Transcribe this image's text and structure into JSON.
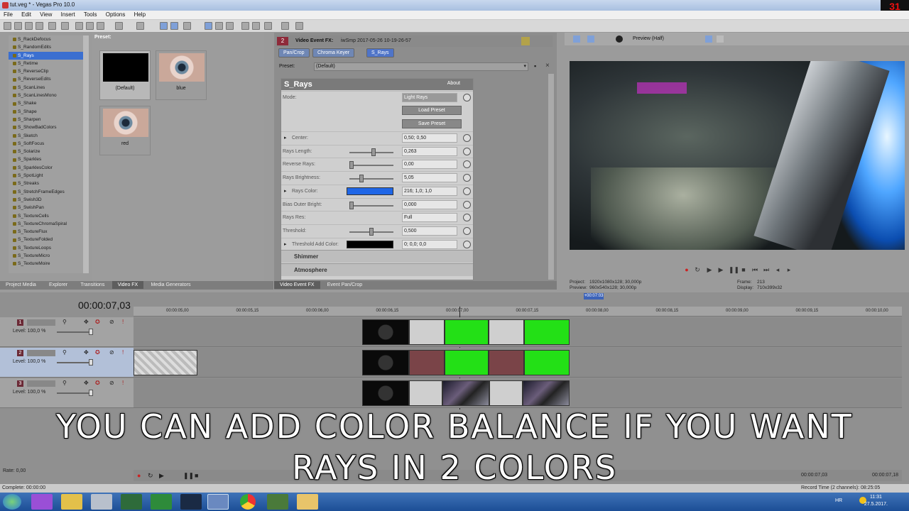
{
  "window": {
    "title": "tut.veg * - Vegas Pro 10.0",
    "corner_counter": "31"
  },
  "menu": [
    "File",
    "Edit",
    "View",
    "Insert",
    "Tools",
    "Options",
    "Help"
  ],
  "fx_list": {
    "items": [
      "S_RackDefocus",
      "S_RandomEdits",
      "S_Rays",
      "S_Retime",
      "S_ReverseClip",
      "S_ReverseEdits",
      "S_ScanLines",
      "S_ScanLinesMono",
      "S_Shake",
      "S_Shape",
      "S_Sharpen",
      "S_ShowBadColors",
      "S_Sketch",
      "S_SoftFocus",
      "S_Solarize",
      "S_Sparkles",
      "S_SparklesColor",
      "S_SpotLight",
      "S_Streaks",
      "S_StretchFrameEdges",
      "S_Swish3D",
      "S_SwishPan",
      "S_TextureCells",
      "S_TextureChromaSpiral",
      "S_TextureFlux",
      "S_TextureFolded",
      "S_TextureLoops",
      "S_TextureMicro",
      "S_TextureMoire"
    ],
    "selected": "S_Rays"
  },
  "presets": {
    "label": "Preset:",
    "items": [
      "(Default)",
      "blue",
      "red"
    ]
  },
  "left_tabs": [
    "Project Media",
    "Explorer",
    "Transitions",
    "Video FX",
    "Media Generators"
  ],
  "left_tabs_active": "Video FX",
  "fx_window": {
    "title": "Video Event FX:",
    "event": "iwSmp 2017-05-26 10-19-26-57",
    "badge": "2",
    "chain": [
      "Pan/Crop",
      "Chroma Keyer",
      "S_Rays"
    ],
    "preset_label": "Preset:",
    "preset_value": "(Default)"
  },
  "srays": {
    "title": "S_Rays",
    "about": "About",
    "mode_label": "Mode:",
    "mode_value": "Light Rays",
    "load_preset": "Load Preset",
    "save_preset": "Save Preset",
    "params": [
      {
        "label": "Center:",
        "value": "0,50; 0,50",
        "expand": true
      },
      {
        "label": "Rays Length:",
        "value": "0,263",
        "slider": 0.55
      },
      {
        "label": "Reverse Rays:",
        "value": "0,00",
        "slider": 0.0
      },
      {
        "label": "Rays Brightness:",
        "value": "5,05",
        "slider": 0.25
      },
      {
        "label": "Rays Color:",
        "value": "216; 1,0; 1,0",
        "expand": true,
        "swatch": "#1f66e6"
      },
      {
        "label": "Bias Outer Bright:",
        "value": "0,000",
        "slider": 0.0
      },
      {
        "label": "Rays Res:",
        "value": "Full"
      },
      {
        "label": "Threshold:",
        "value": "0,500",
        "slider": 0.5
      },
      {
        "label": "Threshold Add Color:",
        "value": "0; 0,0; 0,0",
        "expand": true,
        "swatch": "#000000"
      }
    ],
    "sections": [
      "Shimmer",
      "Atmosphere"
    ]
  },
  "mid_tabs": [
    "Video Event FX",
    "Event Pan/Crop"
  ],
  "preview": {
    "mode": "Preview (Half)",
    "project": "Project:",
    "project_value": "1920x1080x128; 30,000p",
    "preview_label": "Preview:",
    "preview_value": "960x540x128; 30,000p",
    "frame_label": "Frame:",
    "frame_value": "213",
    "display_label": "Display:",
    "display_value": "710x399x32"
  },
  "timeline": {
    "timecode": "00:00:07,03",
    "ruler": [
      "00:00:05,00",
      "00:00:05,15",
      "00:00:06,00",
      "00:00:06,15",
      "00:00:07,00",
      "00:00:07,15",
      "00:00:08,00",
      "00:00:08,15",
      "00:00:09,00",
      "00:00:09,15",
      "00:00:10,00"
    ],
    "marker": "+00:07:03",
    "tracks": [
      {
        "num": "1",
        "level": "Level: 100,0 %"
      },
      {
        "num": "2",
        "level": "Level: 100,0 %"
      },
      {
        "num": "3",
        "level": "Level: 100,0 %"
      }
    ],
    "rate": "Rate: 0,00",
    "end_time": "00:00:07,03",
    "end_time2": "00:00:07,18",
    "record_time": "Record Time (2 channels): 08:25:05"
  },
  "status": "Complete: 00:00:00",
  "caption": [
    "YOU CAN ADD COLOR BALANCE IF YOU WANT",
    "RAYS IN 2 COLORS"
  ],
  "taskbar": {
    "lang": "HR",
    "time": "11:31",
    "date": "27.5.2017."
  }
}
